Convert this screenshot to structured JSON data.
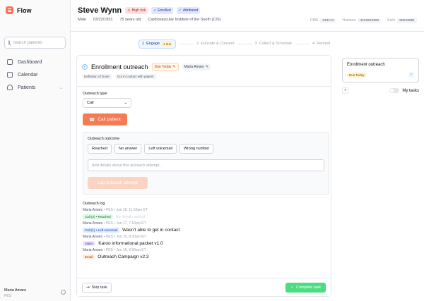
{
  "app": {
    "name": "Flow"
  },
  "sidebar": {
    "search_placeholder": "Search patients",
    "items": [
      {
        "label": "Dashboard"
      },
      {
        "label": "Calendar"
      },
      {
        "label": "Patients"
      }
    ],
    "user": {
      "name": "Maria Amaro",
      "role": "PES"
    }
  },
  "patient": {
    "name": "Steve Wynn",
    "badges": {
      "risk": "High risk",
      "enrolled": "Enrolled",
      "attributed": "Attributed"
    },
    "sex": "Male",
    "dob": "03/22/1951",
    "age": "75 years old",
    "institute": "Cardiovascular Institute of the South (CIS)",
    "ids": [
      {
        "label": "DMS",
        "value": "233111"
      },
      {
        "label": "Humana",
        "value": "H233992992"
      },
      {
        "label": "Kalle",
        "value": "KRH10001"
      }
    ]
  },
  "stepper": {
    "steps": [
      {
        "num": "1",
        "label": "Engage",
        "count": "1 due"
      },
      {
        "num": "2",
        "label": "Educate & Consent"
      },
      {
        "num": "3",
        "label": "Collect & Schedule"
      },
      {
        "num": "4",
        "label": "Remind"
      }
    ]
  },
  "task": {
    "title": "Enrollment outreach",
    "due": "Due Today",
    "assignee": "Maria Amaro",
    "meta": [
      "Definition of Done",
      "Got in contact with patient"
    ],
    "outreach_type_label": "Outreach type",
    "outreach_type_value": "Call",
    "call_button": "Call patient",
    "outcome_label": "Outreach outcome",
    "outcomes": [
      "Reached",
      "No answer",
      "Left voicemail",
      "Wrong number"
    ],
    "details_placeholder": "Add details about this outreach attempt...",
    "log_button": "Log outreach attempt",
    "log_title": "Outreach log",
    "log": [
      {
        "who": "Maria Amaro",
        "role": "PES",
        "date": "Jun 18, 11:10am ET",
        "tag": "Call (2) • Reached",
        "tagcls": "t-green",
        "text": "No details added.",
        "muted": true
      },
      {
        "who": "Maria Amaro",
        "role": "PES",
        "date": "Jun 17, 7:10pm ET",
        "tag": "Call (1) • Left voicemail",
        "tagcls": "t-blue",
        "text": "Wasn't able to get in contact",
        "muted": false
      },
      {
        "who": "Maria Amaro",
        "role": "PES",
        "date": "Jun 15, 8:30am ET",
        "tag": "Mailer",
        "tagcls": "t-purple",
        "text": "Karoo informational packet v1.0",
        "muted": false
      },
      {
        "who": "Maria Amaro",
        "role": "PES",
        "date": "Jun 15, 8:30am ET",
        "tag": "Email",
        "tagcls": "t-orange",
        "text": "Outreach Campaign v2.3",
        "muted": false
      }
    ],
    "skip_button": "Skip task",
    "complete_button": "Complete task"
  },
  "right_panel": {
    "card_title": "Enrollment outreach",
    "card_due": "Due Today",
    "toggle_label": "My tasks"
  },
  "colors": {
    "accent": "#f47b53",
    "success": "#4ade80",
    "primary": "#3b82f6"
  }
}
